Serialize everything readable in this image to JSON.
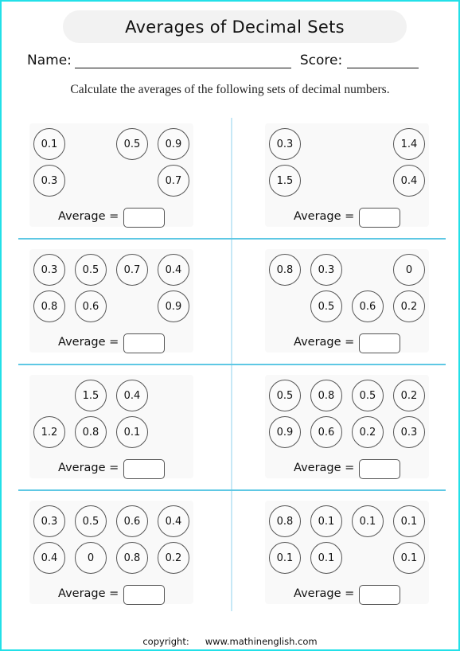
{
  "worksheet": {
    "title": "Averages of Decimal Sets",
    "name_label": "Name:",
    "score_label": "Score:",
    "instructions": "Calculate the averages of the following sets of decimal numbers.",
    "average_label": "Average =",
    "footer": {
      "copyright_label": "copyright:",
      "site": "www.mathinenglish.com"
    },
    "border_color": "#22e0e8",
    "divider_color": "#5ec8e4"
  },
  "problems": [
    {
      "id": 1,
      "rows": [
        [
          "0.1",
          "",
          "0.5",
          "0.9"
        ],
        [
          "0.3",
          "",
          "",
          "0.7"
        ]
      ]
    },
    {
      "id": 2,
      "rows": [
        [
          "0.3",
          "",
          "",
          "1.4"
        ],
        [
          "1.5",
          "",
          "",
          "0.4"
        ]
      ]
    },
    {
      "id": 3,
      "rows": [
        [
          "0.3",
          "0.5",
          "0.7",
          "0.4"
        ],
        [
          "0.8",
          "0.6",
          "",
          "0.9"
        ]
      ]
    },
    {
      "id": 4,
      "rows": [
        [
          "0.8",
          "0.3",
          "",
          "0"
        ],
        [
          "",
          "0.5",
          "0.6",
          "0.2"
        ]
      ]
    },
    {
      "id": 5,
      "rows": [
        [
          "",
          "1.5",
          "0.4",
          ""
        ],
        [
          "1.2",
          "0.8",
          "0.1",
          ""
        ]
      ]
    },
    {
      "id": 6,
      "rows": [
        [
          "0.5",
          "0.8",
          "0.5",
          "0.2"
        ],
        [
          "0.9",
          "0.6",
          "0.2",
          "0.3"
        ]
      ]
    },
    {
      "id": 7,
      "rows": [
        [
          "0.3",
          "0.5",
          "0.6",
          "0.4"
        ],
        [
          "0.4",
          "0",
          "0.8",
          "0.2"
        ]
      ]
    },
    {
      "id": 8,
      "rows": [
        [
          "0.8",
          "0.1",
          "0.1",
          "0.1"
        ],
        [
          "0.1",
          "0.1",
          "",
          "0.1"
        ]
      ]
    }
  ]
}
